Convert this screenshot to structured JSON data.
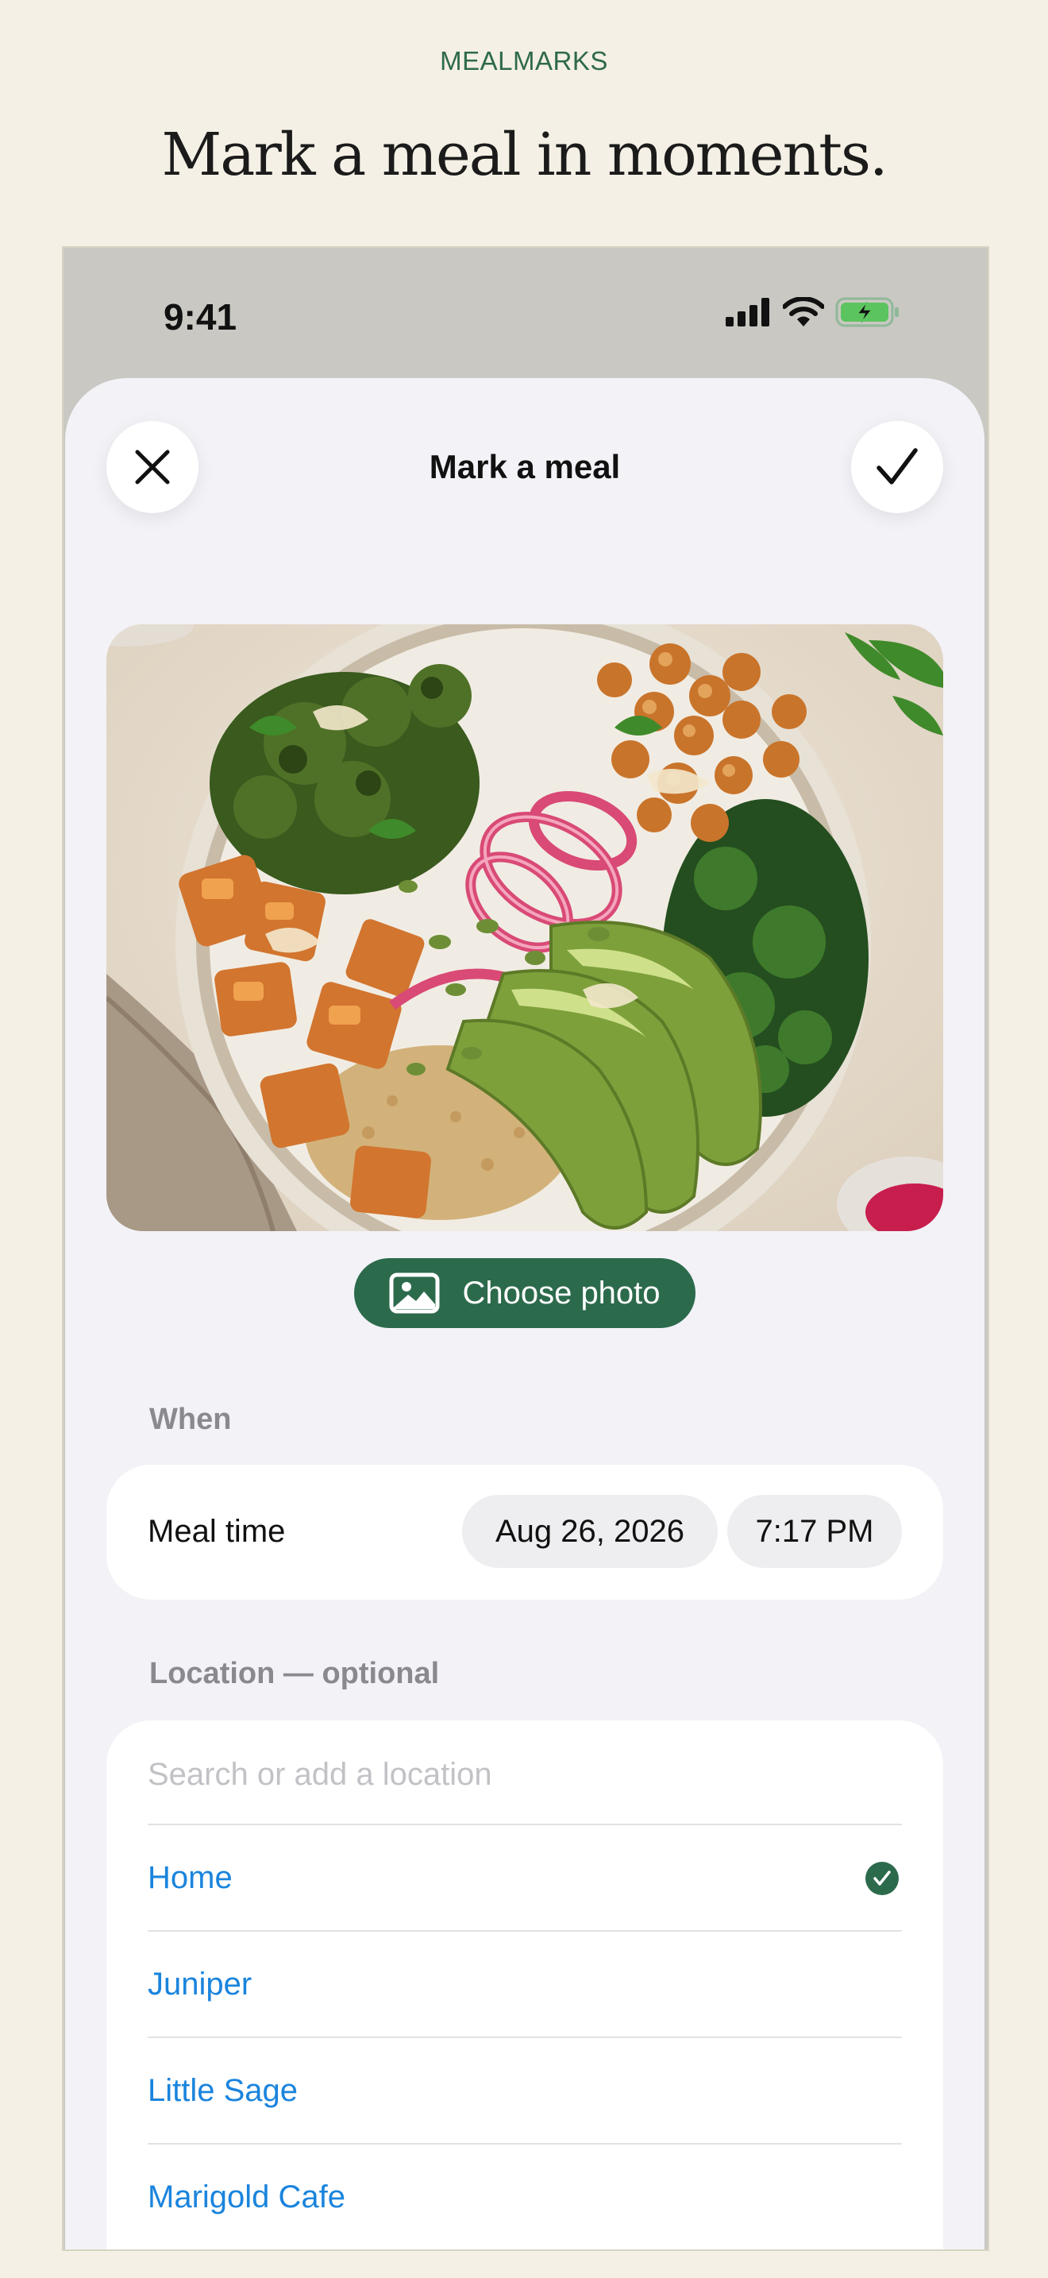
{
  "brand": "MEALMARKS",
  "headline": "Mark a meal in moments.",
  "status_bar": {
    "time": "9:41"
  },
  "nav": {
    "title": "Mark a meal",
    "close_icon": "x-icon",
    "confirm_icon": "checkmark-icon"
  },
  "photo": {
    "choose_label": "Choose photo",
    "choose_icon": "photo-icon"
  },
  "when": {
    "section_label": "When",
    "meal_time_label": "Meal time",
    "date": "Aug 26, 2026",
    "time": "7:17 PM"
  },
  "location": {
    "section_label": "Location — optional",
    "search_placeholder": "Search or add a location",
    "items": [
      {
        "label": "Home",
        "selected": true
      },
      {
        "label": "Juniper",
        "selected": false
      },
      {
        "label": "Little Sage",
        "selected": false
      },
      {
        "label": "Marigold Cafe",
        "selected": false
      }
    ]
  },
  "colors": {
    "accent": "#2c6a4c",
    "link": "#1a84dd",
    "background": "#f4f0e5"
  }
}
